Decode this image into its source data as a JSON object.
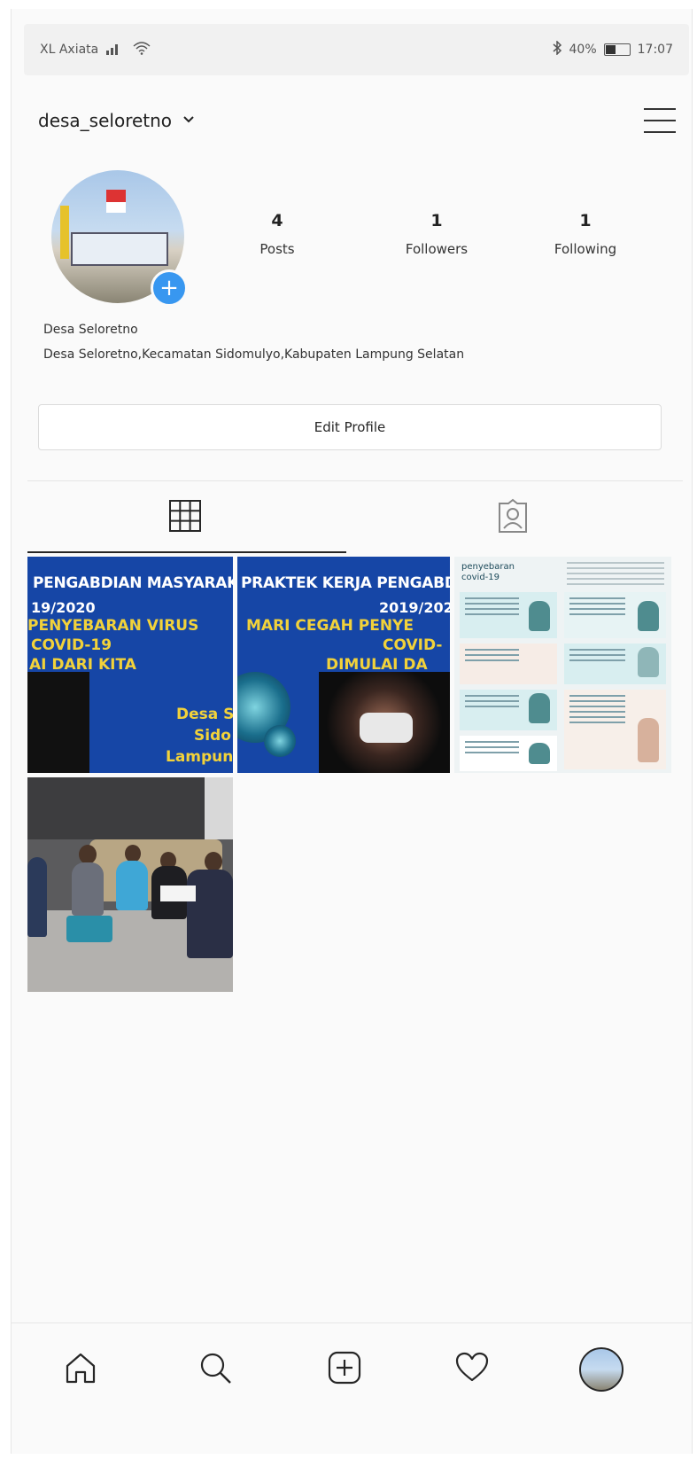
{
  "status_bar": {
    "carrier": "XL Axiata",
    "battery": "40%",
    "time": "17:07"
  },
  "header": {
    "username": "desa_seloretno"
  },
  "profile": {
    "stats": [
      {
        "value": "4",
        "label": "Posts"
      },
      {
        "value": "1",
        "label": "Followers"
      },
      {
        "value": "1",
        "label": "Following"
      }
    ],
    "name": "Desa Seloretno",
    "bio": "Desa Seloretno,Kecamatan Sidomulyo,Kabupaten Lampung Selatan",
    "edit_button": "Edit Profile"
  },
  "posts": [
    {
      "title": "PENGABDIAN MASYARAKAT",
      "year": "19/2020",
      "line1": "PENYEBARAN VIRUS",
      "line2": "COVID-19",
      "line3": "AI DARI KITA",
      "sig1": "Desa S",
      "sig2": "Sido",
      "sig3": "Lampun"
    },
    {
      "title": "PRAKTEK KERJA PENGABD",
      "year": "2019/202",
      "line1": "MARI CEGAH PENYE",
      "line2": "COVID-",
      "line3": "DIMULAI DA"
    },
    {
      "title": "penyebaran\ncovid-19"
    }
  ],
  "colors": {
    "accent": "#3897f0",
    "post_blue": "#1646a6",
    "post_yellow": "#f2d23a"
  },
  "icons": {
    "grid_tab": "grid-icon",
    "tagged_tab": "person-tag-icon",
    "nav": [
      "home-icon",
      "search-icon",
      "add-post-icon",
      "heart-icon",
      "profile-avatar"
    ]
  }
}
